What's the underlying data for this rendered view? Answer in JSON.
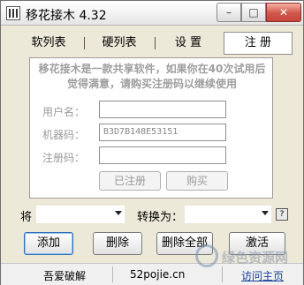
{
  "window": {
    "title": "移花接木 4.32",
    "minimize_glyph": "–",
    "maximize_glyph": "□",
    "close_glyph": "✕"
  },
  "tabs": [
    {
      "label": "软列表"
    },
    {
      "label": "硬列表"
    },
    {
      "label": "设 置"
    },
    {
      "label": "注 册",
      "active": true
    }
  ],
  "register": {
    "notice": "移花接木是一款共享软件，如果你在40次试用后觉得满意，请购买注册码以继续使用",
    "username_label": "用户名：",
    "username_value": "",
    "machine_label": "机器码：",
    "machine_value": "B3D7B148E53151",
    "regcode_label": "注册码：",
    "regcode_value": "",
    "registered_button": "已注册",
    "buy_button": "购买"
  },
  "convert": {
    "from_label": "将",
    "from_value": "",
    "to_label": "转换为：",
    "to_value": "",
    "help_glyph": "?"
  },
  "actions": {
    "add": "添加",
    "delete": "删除",
    "delete_all": "删除全部",
    "activate": "激活"
  },
  "statusbar": {
    "left": "吾爱破解",
    "middle": "52pojie.cn",
    "right": "访问主页"
  },
  "watermark": {
    "text": "绿色资源网"
  },
  "colors": {
    "active_tab_bg": "#ffffff",
    "close_button": "#c6453a",
    "disabled_text": "#9a9a9a",
    "link": "#1a3f9a"
  },
  "icons": {
    "app": "app-icon",
    "dropdown": "chevron-down-icon",
    "help": "help-icon"
  }
}
